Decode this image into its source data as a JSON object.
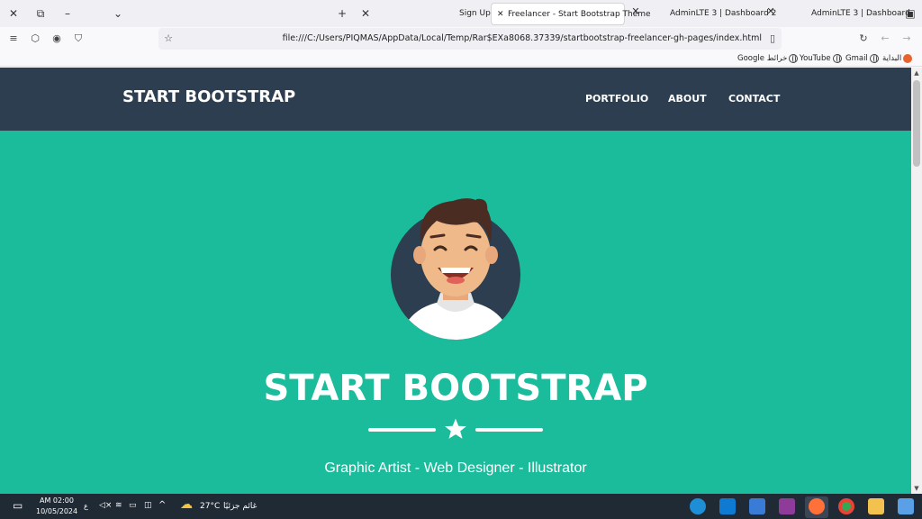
{
  "browser": {
    "tabs": [
      {
        "label": "Sign Up"
      },
      {
        "label": "Freelancer - Start Bootstrap Theme"
      },
      {
        "label": "AdminLTE 3 | Dashboard 2"
      },
      {
        "label": "AdminLTE 3 | Dashboard"
      }
    ],
    "url": "file:///C:/Users/PIQMAS/AppData/Local/Temp/Rar$EXa8068.37339/startbootstrap-freelancer-gh-pages/index.html",
    "bookmarks": [
      "Google خرائط",
      "YouTube",
      "Gmail",
      "البداية"
    ]
  },
  "site": {
    "brand": "START BOOTSTRAP",
    "menu": [
      "PORTFOLIO",
      "ABOUT",
      "CONTACT"
    ],
    "hero_title": "START BOOTSTRAP",
    "subtitle": "Graphic Artist - Web Designer - Illustrator",
    "colors": {
      "nav": "#2c3e50",
      "primary": "#1abc9c"
    }
  },
  "taskbar": {
    "time": "AM 02:00",
    "date": "10/05/2024",
    "lang": "ع",
    "weather_temp": "27°C",
    "weather_text": "غائم جزئيًا"
  }
}
